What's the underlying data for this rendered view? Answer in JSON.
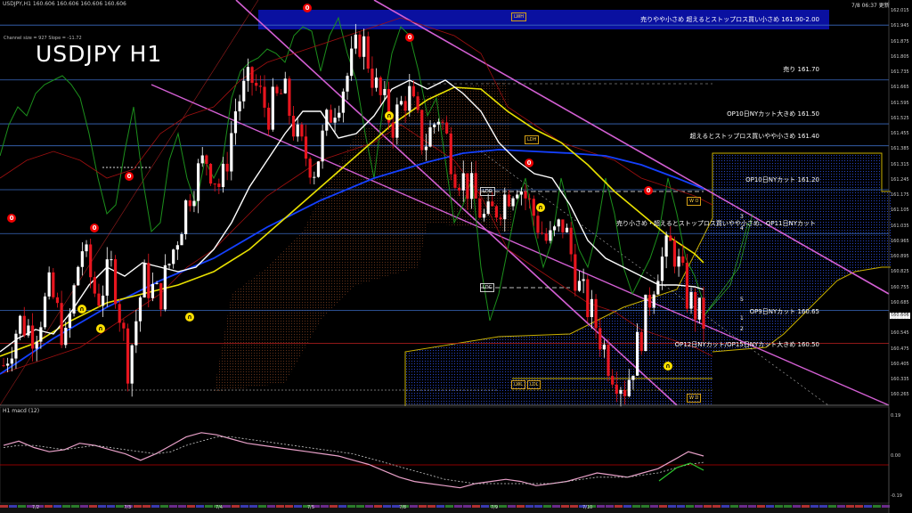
{
  "header": {
    "symbol_line": "USDJPY,H1  160.606 160.606 160.606 160.606",
    "chart_title": "USDJPY H1",
    "channel_info": "Channel size = 927 Slope = -11.72",
    "clock": "7/8 06:37 更新",
    "subwindow_label": "H1 macd (12)"
  },
  "levels": [
    {
      "key": "lv1",
      "text": "売りやや小さめ 超えるとストップロス買い小さめ 161.90-2.00",
      "price": 161.95
    },
    {
      "key": "lv2",
      "text": "売り 161.70",
      "price": 161.7
    },
    {
      "key": "lv3",
      "text": "OP10日NYカット大きめ 161.50",
      "price": 161.5
    },
    {
      "key": "lv4",
      "text": "超えるとストップロス買いやや小さめ 161.40",
      "price": 161.4
    },
    {
      "key": "lv5",
      "text": "OP10日NYカット 161.20",
      "price": 161.2
    },
    {
      "key": "lv6",
      "text": "売り小さめ・超えるとストップロス買いやや小さめ、OP11日NYカット",
      "price": 161.0
    },
    {
      "key": "lv7",
      "text": "OP9日NYカット 160.65",
      "price": 160.65
    },
    {
      "key": "lv8",
      "text": "OP12日NYカット/OP15日NYカット大きめ 160.50",
      "price": 160.5
    }
  ],
  "boxes": {
    "lwh": "LWH",
    "ldh": "LDH",
    "ldo": "LDO",
    "ldc": "LDC",
    "lwl": "LWL",
    "ldl": "LDL",
    "wo": "W O",
    "wd": "W D"
  },
  "channel_nums": {
    "n1": "1",
    "n2": "2",
    "n3": "3",
    "n4": "4",
    "n5": "5"
  },
  "last_price": "160.606",
  "yaxis_main": {
    "ticks": [
      "162.015",
      "161.945",
      "161.875",
      "161.805",
      "161.735",
      "161.665",
      "161.595",
      "161.525",
      "161.455",
      "161.385",
      "161.315",
      "161.245",
      "161.175",
      "161.105",
      "161.035",
      "160.965",
      "160.895",
      "160.825",
      "160.755",
      "160.685",
      "160.615",
      "160.545",
      "160.475",
      "160.405",
      "160.335",
      "160.265"
    ],
    "min": 160.23,
    "max": 162.04
  },
  "yaxis_macd": {
    "ticks": [
      "0.19",
      "0.00",
      "-0.19"
    ],
    "min": -0.21,
    "max": 0.21
  },
  "xaxis": {
    "dates": [
      "7/2",
      "7/3",
      "7/4",
      "7/5",
      "7/8",
      "7/9",
      "7/10"
    ]
  },
  "colors": {
    "up": "#ffffff",
    "down": "#e8151e",
    "ma_fast": "#ffffff",
    "ma_mid": "#e8e000",
    "ma_slow": "#1440ff",
    "channel": "#d35fd3",
    "band": "#1c8f1c",
    "cloud": "#2a4ad8",
    "banner": "#0a10a0"
  },
  "chart_data": {
    "type": "candlestick",
    "title": "USDJPY H1",
    "x_dates": [
      "7/2",
      "7/3",
      "7/4",
      "7/5",
      "7/8",
      "7/9",
      "7/10"
    ],
    "close_path": [
      160.4,
      160.6,
      160.55,
      160.75,
      160.5,
      160.95,
      160.7,
      160.85,
      160.4,
      160.8,
      160.7,
      160.95,
      161.2,
      161.35,
      161.2,
      161.6,
      161.7,
      161.55,
      161.65,
      161.4,
      161.3,
      161.55,
      161.7,
      161.9,
      161.65,
      161.5,
      161.65,
      161.4,
      161.55,
      161.3,
      161.2,
      161.05,
      161.15,
      161.25,
      161.1,
      160.95,
      161.05,
      160.75,
      160.6,
      160.4,
      160.3,
      160.55,
      160.85,
      160.95,
      160.7,
      160.6
    ],
    "macd": [
      0.05,
      0.07,
      0.04,
      0.02,
      0.03,
      0.06,
      0.05,
      0.03,
      0.01,
      -0.02,
      0.01,
      0.05,
      0.09,
      0.11,
      0.1,
      0.08,
      0.06,
      0.05,
      0.04,
      0.03,
      0.02,
      0.01,
      0.0,
      -0.02,
      -0.04,
      -0.07,
      -0.1,
      -0.12,
      -0.13,
      -0.14,
      -0.15,
      -0.13,
      -0.12,
      -0.11,
      -0.12,
      -0.14,
      -0.13,
      -0.12,
      -0.1,
      -0.08,
      -0.09,
      -0.1,
      -0.08,
      -0.06,
      -0.02,
      0.02,
      0.0
    ],
    "signal": [
      0.04,
      0.05,
      0.05,
      0.04,
      0.03,
      0.04,
      0.05,
      0.04,
      0.03,
      0.02,
      0.01,
      0.02,
      0.05,
      0.07,
      0.09,
      0.09,
      0.08,
      0.07,
      0.06,
      0.05,
      0.04,
      0.03,
      0.02,
      0.01,
      -0.01,
      -0.03,
      -0.05,
      -0.07,
      -0.09,
      -0.11,
      -0.12,
      -0.13,
      -0.13,
      -0.13,
      -0.13,
      -0.13,
      -0.13,
      -0.12,
      -0.11,
      -0.1,
      -0.1,
      -0.1,
      -0.09,
      -0.08,
      -0.06,
      -0.04,
      -0.03
    ]
  }
}
